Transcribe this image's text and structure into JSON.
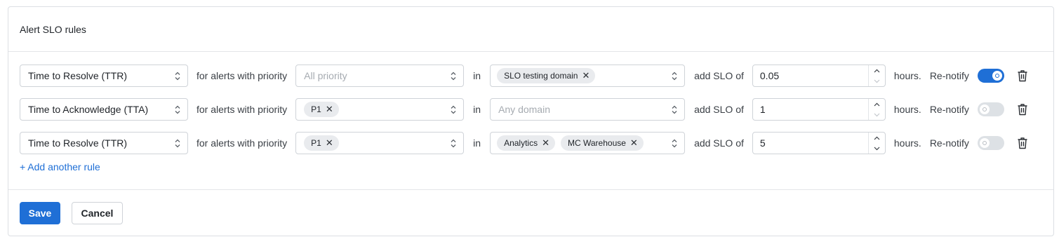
{
  "card": {
    "title": "Alert SLO rules"
  },
  "labels": {
    "for_alerts": "for alerts with priority",
    "in": "in",
    "add_slo": "add SLO of",
    "hours": "hours.",
    "renotify": "Re-notify"
  },
  "rules": [
    {
      "metric": "Time to Resolve (TTR)",
      "priority_placeholder": "All priority",
      "priority_chips": [],
      "domain_placeholder": "",
      "domain_chips": [
        "SLO testing domain"
      ],
      "slo_value": "0.05",
      "renotify": true
    },
    {
      "metric": "Time to Acknowledge (TTA)",
      "priority_placeholder": "",
      "priority_chips": [
        "P1"
      ],
      "domain_placeholder": "Any domain",
      "domain_chips": [],
      "slo_value": "1",
      "renotify": false
    },
    {
      "metric": "Time to Resolve (TTR)",
      "priority_placeholder": "",
      "priority_chips": [
        "P1"
      ],
      "domain_placeholder": "",
      "domain_chips": [
        "Analytics",
        "MC Warehouse"
      ],
      "slo_value": "5",
      "renotify": false
    }
  ],
  "add_rule_label": "+ Add another rule",
  "footer": {
    "save_label": "Save",
    "cancel_label": "Cancel"
  },
  "colors": {
    "primary": "#1f6fd6",
    "chip_bg": "#e9ebee",
    "border": "#cfd3d8"
  },
  "icons": {
    "select": "chevron-updown-icon",
    "chip_remove": "close-icon",
    "delete": "trash-icon"
  }
}
